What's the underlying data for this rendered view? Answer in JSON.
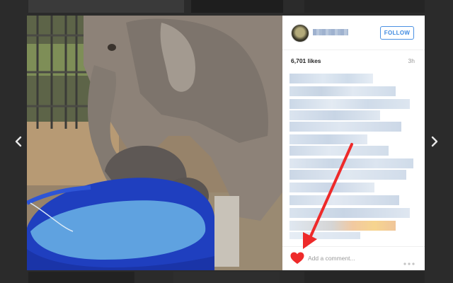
{
  "post": {
    "likes": "6,701 likes",
    "timestamp": "3h",
    "follow_label": "FOLLOW"
  },
  "comment": {
    "placeholder": "Add a comment..."
  },
  "icons": {
    "nav_prev": "chevron-left-icon",
    "nav_next": "chevron-right-icon",
    "like": "heart-icon",
    "more": "more-options-icon"
  },
  "colors": {
    "accent": "#3f8ae0",
    "like_heart": "#ee2a2a",
    "annotation_arrow": "#ee2a2a"
  }
}
